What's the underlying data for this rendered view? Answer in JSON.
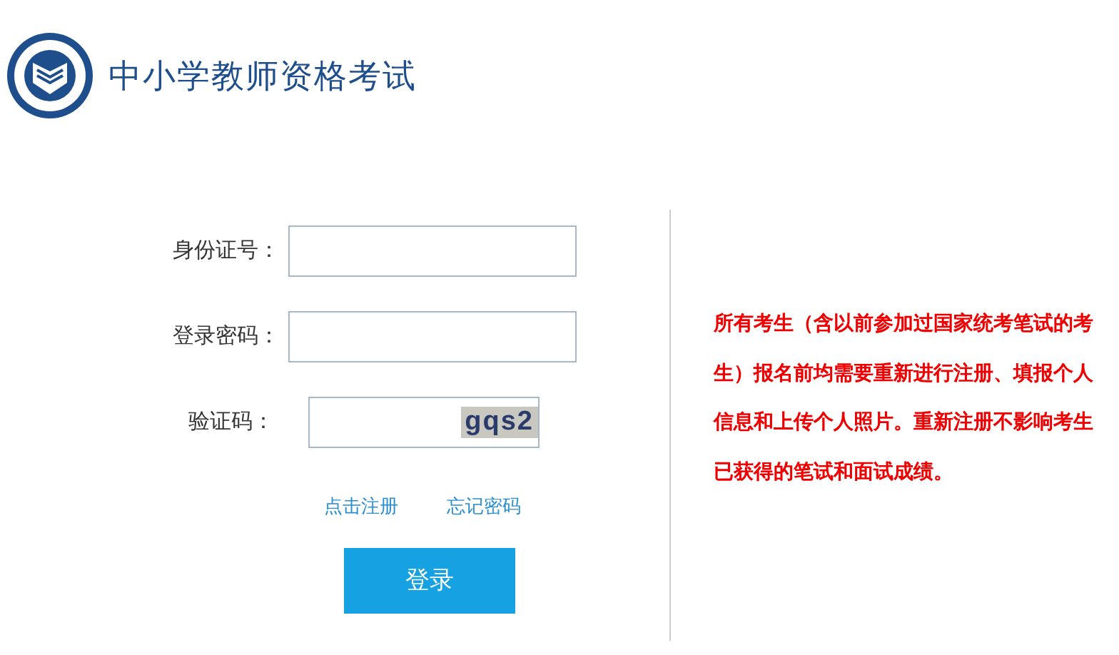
{
  "header": {
    "title": "中小学教师资格考试"
  },
  "form": {
    "fields": [
      {
        "label": "身份证号："
      },
      {
        "label": "登录密码："
      }
    ],
    "captcha": {
      "label": "验证码：",
      "code": "gqs2"
    },
    "links": [
      "点击注册",
      "忘记密码"
    ],
    "submit": "登录"
  },
  "notice": "所有考生（含以前参加过国家统考笔试的考生）报名前均需要重新进行注册、填报个人信息和上传个人照片。重新注册不影响考生已获得的笔试和面试成绩。"
}
